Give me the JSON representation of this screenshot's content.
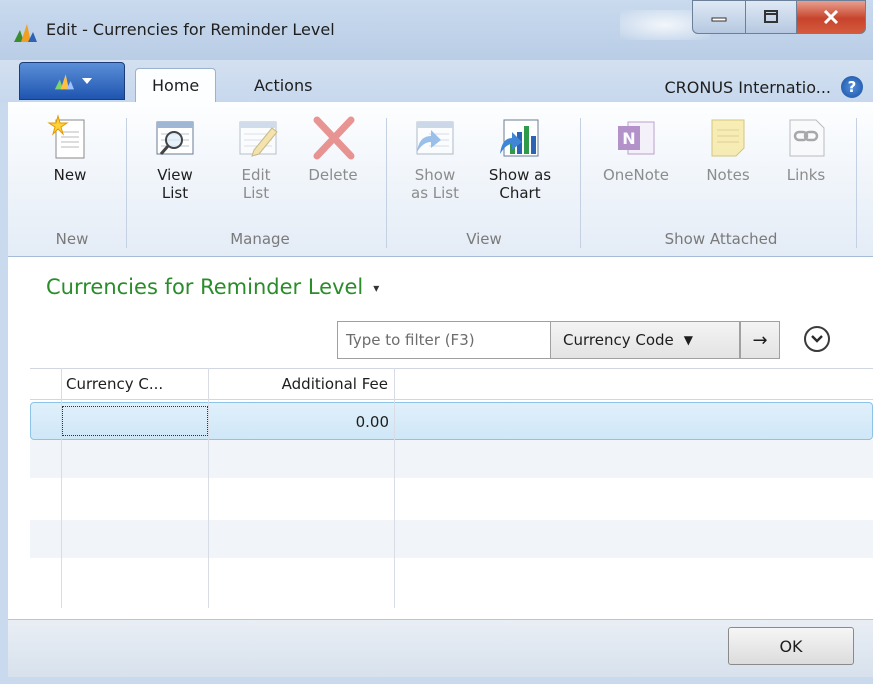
{
  "window": {
    "title": "Edit - Currencies for Reminder Level"
  },
  "ribbon": {
    "tabs": [
      {
        "label": "Home"
      },
      {
        "label": "Actions"
      }
    ],
    "company": "CRONUS Internatio...",
    "help_label": "?",
    "groups": {
      "new": {
        "label": "New",
        "buttons": {
          "new": "New"
        }
      },
      "manage": {
        "label": "Manage",
        "buttons": {
          "view_list_1": "View",
          "view_list_2": "List",
          "edit_list_1": "Edit",
          "edit_list_2": "List",
          "delete": "Delete"
        }
      },
      "view": {
        "label": "View",
        "buttons": {
          "show_as_list_1": "Show",
          "show_as_list_2": "as List",
          "show_as_chart_1": "Show as",
          "show_as_chart_2": "Chart"
        }
      },
      "show_attached": {
        "label": "Show Attached",
        "buttons": {
          "onenote": "OneNote",
          "notes": "Notes",
          "links": "Links"
        }
      }
    }
  },
  "page": {
    "title": "Currencies for Reminder Level",
    "title_dropdown": "▾"
  },
  "filter": {
    "placeholder": "Type to filter (F3)",
    "field": "Currency Code",
    "field_arrow": "▼",
    "go": "→"
  },
  "grid": {
    "columns": [
      "Currency C...",
      "Additional Fee"
    ],
    "rows": [
      {
        "currency_code": "",
        "additional_fee": "0.00"
      }
    ]
  },
  "footer": {
    "ok_label": "OK"
  },
  "colors": {
    "title_green": "#2a8c2a",
    "selection_blue": "#cfe7f7",
    "close_red": "#c7442c"
  }
}
